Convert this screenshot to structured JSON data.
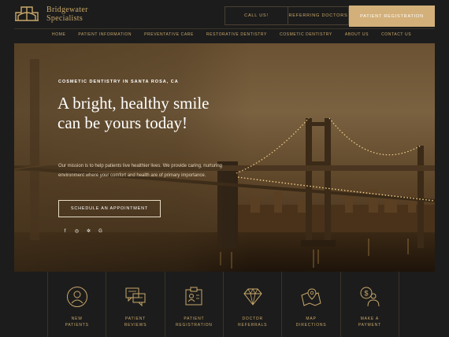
{
  "brand": {
    "line1": "Bridgewater",
    "line2": "Specialists",
    "icon": "bridge-logo-icon"
  },
  "header": {
    "call_label": "CALL US!",
    "referring_label": "REFERRING DOCTORS",
    "patient_registration_label": "PATIENT REGISTRATION"
  },
  "nav": {
    "items": [
      {
        "label": "HOME"
      },
      {
        "label": "PATIENT INFORMATION"
      },
      {
        "label": "PREVENTATIVE CARE"
      },
      {
        "label": "RESTORATIVE DENTISTRY"
      },
      {
        "label": "COSMETIC DENTISTRY"
      },
      {
        "label": "ABOUT US"
      },
      {
        "label": "CONTACT US"
      }
    ]
  },
  "hero": {
    "eyebrow": "COSMETIC DENTISTRY IN SANTA ROSA, CA",
    "headline": "A bright, healthy smile can be yours today!",
    "mission": "Our mission is to help patients live healthier lives. We provide caring, nurturing environment where your comfort and health are of primary importance.",
    "cta_label": "SCHEDULE AN APPOINTMENT",
    "social": [
      {
        "icon": "facebook-icon",
        "glyph": "f"
      },
      {
        "icon": "instagram-icon",
        "glyph": "◎"
      },
      {
        "icon": "yelp-icon",
        "glyph": "✲"
      },
      {
        "icon": "google-icon",
        "glyph": "G"
      }
    ]
  },
  "quick_links": [
    {
      "line1": "NEW",
      "line2": "PATIENTS",
      "icon": "person-icon"
    },
    {
      "line1": "PATIENT",
      "line2": "REVIEWS",
      "icon": "reviews-chat-icon"
    },
    {
      "line1": "PATIENT",
      "line2": "REGISTRATION",
      "icon": "registration-form-icon"
    },
    {
      "line1": "DOCTOR",
      "line2": "REFERRALS",
      "icon": "diamond-icon"
    },
    {
      "line1": "MAP",
      "line2": "DIRECTIONS",
      "icon": "map-pin-icon"
    },
    {
      "line1": "MAKE A",
      "line2": "PAYMENT",
      "icon": "payment-person-icon"
    }
  ],
  "colors": {
    "background": "#1c1c1c",
    "accent": "#c9a86a",
    "cta": "#d3b07a"
  }
}
